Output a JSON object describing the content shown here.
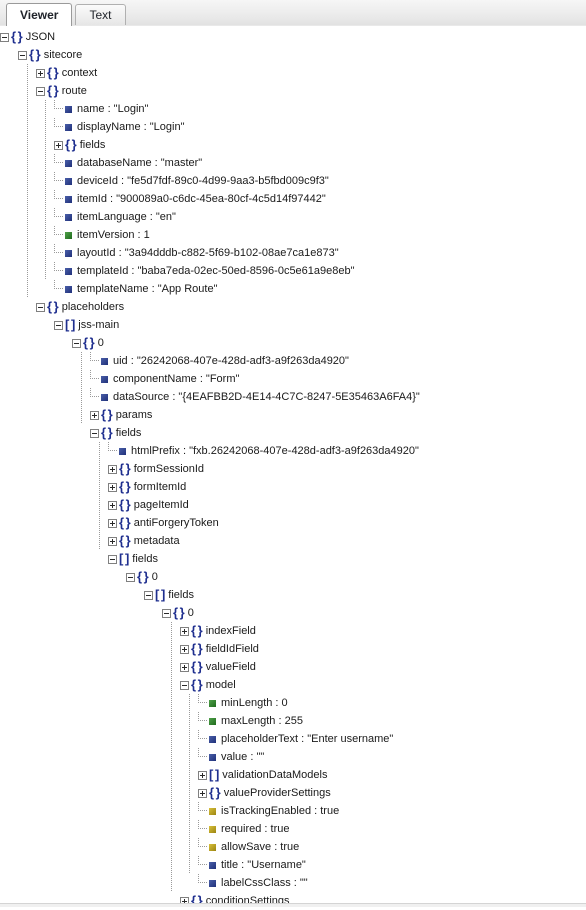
{
  "tabs": [
    {
      "label": "Viewer",
      "active": true
    },
    {
      "label": "Text",
      "active": false
    }
  ],
  "tree": [
    {
      "depth": 0,
      "kind": "object",
      "expander": "minus",
      "label": "JSON"
    },
    {
      "depth": 1,
      "kind": "object",
      "expander": "minus",
      "label": "sitecore"
    },
    {
      "depth": 2,
      "kind": "object",
      "expander": "plus",
      "label": "context"
    },
    {
      "depth": 2,
      "kind": "object",
      "expander": "minus",
      "label": "route"
    },
    {
      "depth": 3,
      "kind": "leaf",
      "valueType": "string",
      "label": "name : \"Login\""
    },
    {
      "depth": 3,
      "kind": "leaf",
      "valueType": "string",
      "label": "displayName : \"Login\""
    },
    {
      "depth": 3,
      "kind": "object",
      "expander": "plus",
      "label": "fields"
    },
    {
      "depth": 3,
      "kind": "leaf",
      "valueType": "string",
      "label": "databaseName : \"master\""
    },
    {
      "depth": 3,
      "kind": "leaf",
      "valueType": "string",
      "label": "deviceId : \"fe5d7fdf-89c0-4d99-9aa3-b5fbd009c9f3\""
    },
    {
      "depth": 3,
      "kind": "leaf",
      "valueType": "string",
      "label": "itemId : \"900089a0-c6dc-45ea-80cf-4c5d14f97442\""
    },
    {
      "depth": 3,
      "kind": "leaf",
      "valueType": "string",
      "label": "itemLanguage : \"en\""
    },
    {
      "depth": 3,
      "kind": "leaf",
      "valueType": "number",
      "label": "itemVersion : 1"
    },
    {
      "depth": 3,
      "kind": "leaf",
      "valueType": "string",
      "label": "layoutId : \"3a94dddb-c882-5f69-b102-08ae7ca1e873\""
    },
    {
      "depth": 3,
      "kind": "leaf",
      "valueType": "string",
      "label": "templateId : \"baba7eda-02ec-50ed-8596-0c5e61a9e8eb\""
    },
    {
      "depth": 3,
      "kind": "leaf",
      "valueType": "string",
      "label": "templateName : \"App Route\""
    },
    {
      "depth": 2,
      "kind": "object",
      "expander": "minus",
      "label": "placeholders"
    },
    {
      "depth": 3,
      "kind": "array",
      "expander": "minus",
      "label": "jss-main"
    },
    {
      "depth": 4,
      "kind": "object",
      "expander": "minus",
      "label": "0"
    },
    {
      "depth": 5,
      "kind": "leaf",
      "valueType": "string",
      "label": "uid : \"26242068-407e-428d-adf3-a9f263da4920\""
    },
    {
      "depth": 5,
      "kind": "leaf",
      "valueType": "string",
      "label": "componentName : \"Form\""
    },
    {
      "depth": 5,
      "kind": "leaf",
      "valueType": "string",
      "label": "dataSource : \"{4EAFBB2D-4E14-4C7C-8247-5E35463A6FA4}\""
    },
    {
      "depth": 5,
      "kind": "object",
      "expander": "plus",
      "label": "params"
    },
    {
      "depth": 5,
      "kind": "object",
      "expander": "minus",
      "label": "fields"
    },
    {
      "depth": 6,
      "kind": "leaf",
      "valueType": "string",
      "label": "htmlPrefix : \"fxb.26242068-407e-428d-adf3-a9f263da4920\""
    },
    {
      "depth": 6,
      "kind": "object",
      "expander": "plus",
      "label": "formSessionId"
    },
    {
      "depth": 6,
      "kind": "object",
      "expander": "plus",
      "label": "formItemId"
    },
    {
      "depth": 6,
      "kind": "object",
      "expander": "plus",
      "label": "pageItemId"
    },
    {
      "depth": 6,
      "kind": "object",
      "expander": "plus",
      "label": "antiForgeryToken"
    },
    {
      "depth": 6,
      "kind": "object",
      "expander": "plus",
      "label": "metadata"
    },
    {
      "depth": 6,
      "kind": "array",
      "expander": "minus",
      "label": "fields"
    },
    {
      "depth": 7,
      "kind": "object",
      "expander": "minus",
      "label": "0"
    },
    {
      "depth": 8,
      "kind": "array",
      "expander": "minus",
      "label": "fields"
    },
    {
      "depth": 9,
      "kind": "object",
      "expander": "minus",
      "label": "0"
    },
    {
      "depth": 10,
      "kind": "object",
      "expander": "plus",
      "label": "indexField"
    },
    {
      "depth": 10,
      "kind": "object",
      "expander": "plus",
      "label": "fieldIdField"
    },
    {
      "depth": 10,
      "kind": "object",
      "expander": "plus",
      "label": "valueField"
    },
    {
      "depth": 10,
      "kind": "object",
      "expander": "minus",
      "label": "model"
    },
    {
      "depth": 11,
      "kind": "leaf",
      "valueType": "number",
      "label": "minLength : 0"
    },
    {
      "depth": 11,
      "kind": "leaf",
      "valueType": "number",
      "label": "maxLength : 255"
    },
    {
      "depth": 11,
      "kind": "leaf",
      "valueType": "string",
      "label": "placeholderText : \"Enter username\""
    },
    {
      "depth": 11,
      "kind": "leaf",
      "valueType": "string",
      "label": "value : \"\""
    },
    {
      "depth": 11,
      "kind": "array",
      "expander": "plus",
      "label": "validationDataModels"
    },
    {
      "depth": 11,
      "kind": "object",
      "expander": "plus",
      "label": "valueProviderSettings"
    },
    {
      "depth": 11,
      "kind": "leaf",
      "valueType": "boolean",
      "label": "isTrackingEnabled : true"
    },
    {
      "depth": 11,
      "kind": "leaf",
      "valueType": "boolean",
      "label": "required : true"
    },
    {
      "depth": 11,
      "kind": "leaf",
      "valueType": "boolean",
      "label": "allowSave : true"
    },
    {
      "depth": 11,
      "kind": "leaf",
      "valueType": "string",
      "label": "title : \"Username\""
    },
    {
      "depth": 11,
      "kind": "leaf",
      "valueType": "string",
      "label": "labelCssClass : \"\""
    },
    {
      "depth": 10,
      "kind": "object",
      "expander": "plus",
      "label": "conditionSettings"
    }
  ],
  "glyphs": {
    "object": "{ }",
    "array": "[ ]"
  }
}
